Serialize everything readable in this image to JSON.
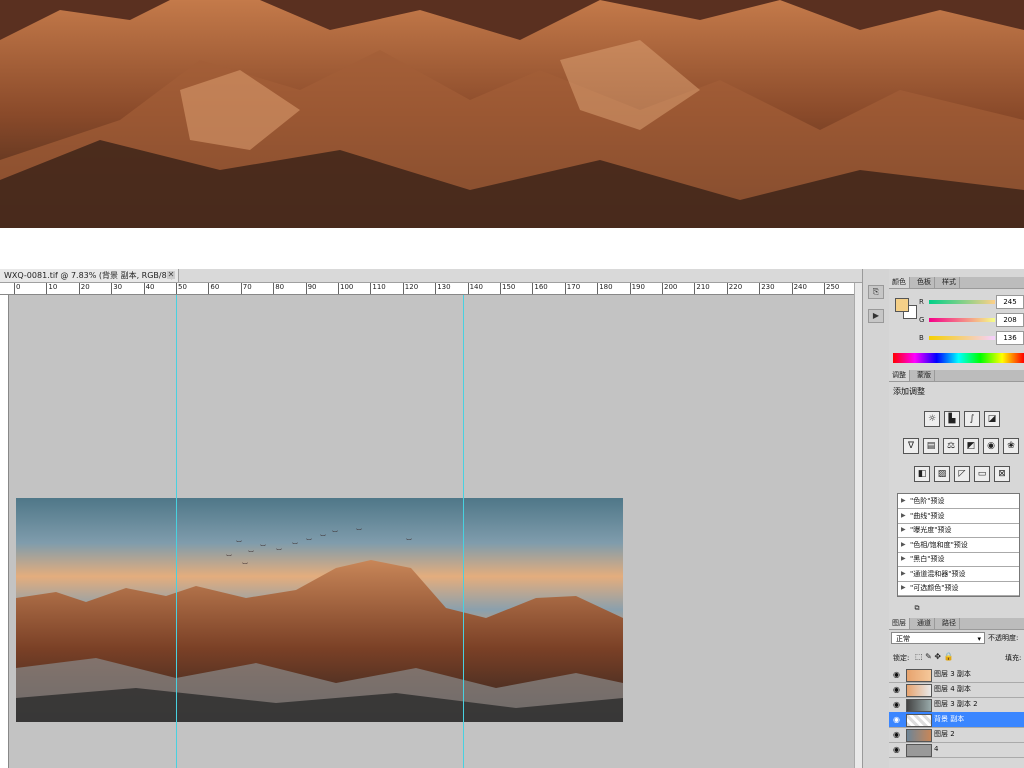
{
  "document": {
    "tab_title": "WXQ-0081.tif @ 7.83% (背景 副本, RGB/8*)",
    "close_symbol": "✕",
    "ruler_ticks": [
      "0",
      "10",
      "20",
      "30",
      "40",
      "50",
      "60",
      "70",
      "80",
      "90",
      "100",
      "110",
      "120",
      "130",
      "140",
      "150",
      "160",
      "170",
      "180",
      "190",
      "200",
      "210",
      "220",
      "230",
      "240",
      "250",
      "2"
    ]
  },
  "color_panel": {
    "tabs": [
      "颜色",
      "色板",
      "样式"
    ],
    "channels": [
      {
        "label": "R",
        "value": "245"
      },
      {
        "label": "G",
        "value": "208"
      },
      {
        "label": "B",
        "value": "136"
      }
    ],
    "foreground_color": "#f5d088"
  },
  "adjustments_panel": {
    "tabs": [
      "调整",
      "蒙版"
    ],
    "heading": "添加调整",
    "presets": [
      "\"色阶\"预设",
      "\"曲线\"预设",
      "\"曝光度\"预设",
      "\"色相/饱和度\"预设",
      "\"黑白\"预设",
      "\"通道混和器\"预设",
      "\"可选颜色\"预设"
    ]
  },
  "layers_panel": {
    "tabs": [
      "图层",
      "通道",
      "路径"
    ],
    "blend_mode": "正常",
    "opacity_label": "不透明度:",
    "lock_label": "锁定:",
    "fill_label": "填充:",
    "layers": [
      {
        "name": "图层 3 副本",
        "selected": false
      },
      {
        "name": "图层 4 副本",
        "selected": false
      },
      {
        "name": "图层 3 副本 2",
        "selected": false
      },
      {
        "name": "背景 副本",
        "selected": true
      },
      {
        "name": "图层 2",
        "selected": false
      },
      {
        "name": "4",
        "selected": false
      }
    ]
  }
}
